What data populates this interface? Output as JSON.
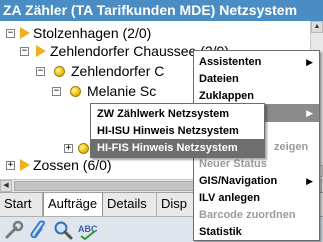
{
  "window": {
    "title": "ZA Zähler (TA Tarifkunden MDE) Netzsystem"
  },
  "tree": {
    "nodes": [
      {
        "label": "Stolzenhagen (2/0)"
      },
      {
        "label": "Zehlendorfer Chaussee (2/0)"
      },
      {
        "label": "Zehlendorfer C"
      },
      {
        "label": "Melanie Sc"
      },
      {
        "label": "Zossen (6/0)"
      }
    ]
  },
  "context_menu": {
    "items": [
      {
        "label": "Assistenten",
        "has_submenu": true
      },
      {
        "label": "Dateien"
      },
      {
        "label": "Zuklappen"
      },
      {
        "label": ""
      },
      {
        "label": ""
      },
      {
        "label": "zeigen",
        "disabled": true
      },
      {
        "label": "Neuer Status",
        "disabled": true
      },
      {
        "label": "GIS/Navigation",
        "has_submenu": true
      },
      {
        "label": "ILV anlegen"
      },
      {
        "label": "Barcode zuordnen",
        "disabled": true
      },
      {
        "label": "Statistik"
      }
    ]
  },
  "submenu": {
    "items": [
      {
        "label": "ZW Zählwerk Netzsystem"
      },
      {
        "label": "HI-ISU Hinweis Netzsystem"
      },
      {
        "label": "HI-FIS Hinweis Netzsystem"
      }
    ]
  },
  "tabs": [
    {
      "label": "Start"
    },
    {
      "label": "Aufträge",
      "active": true
    },
    {
      "label": "Details"
    },
    {
      "label": "Disp"
    }
  ],
  "toolbar": {
    "tools": [
      {
        "icon": "wrench-icon"
      },
      {
        "icon": "paperclip-icon"
      },
      {
        "icon": "magnifier-icon"
      },
      {
        "icon": "spellcheck-icon",
        "text": "ABC"
      }
    ]
  },
  "colors": {
    "titlebar": "#4a8dc4",
    "highlight": "#6e6e6e"
  }
}
